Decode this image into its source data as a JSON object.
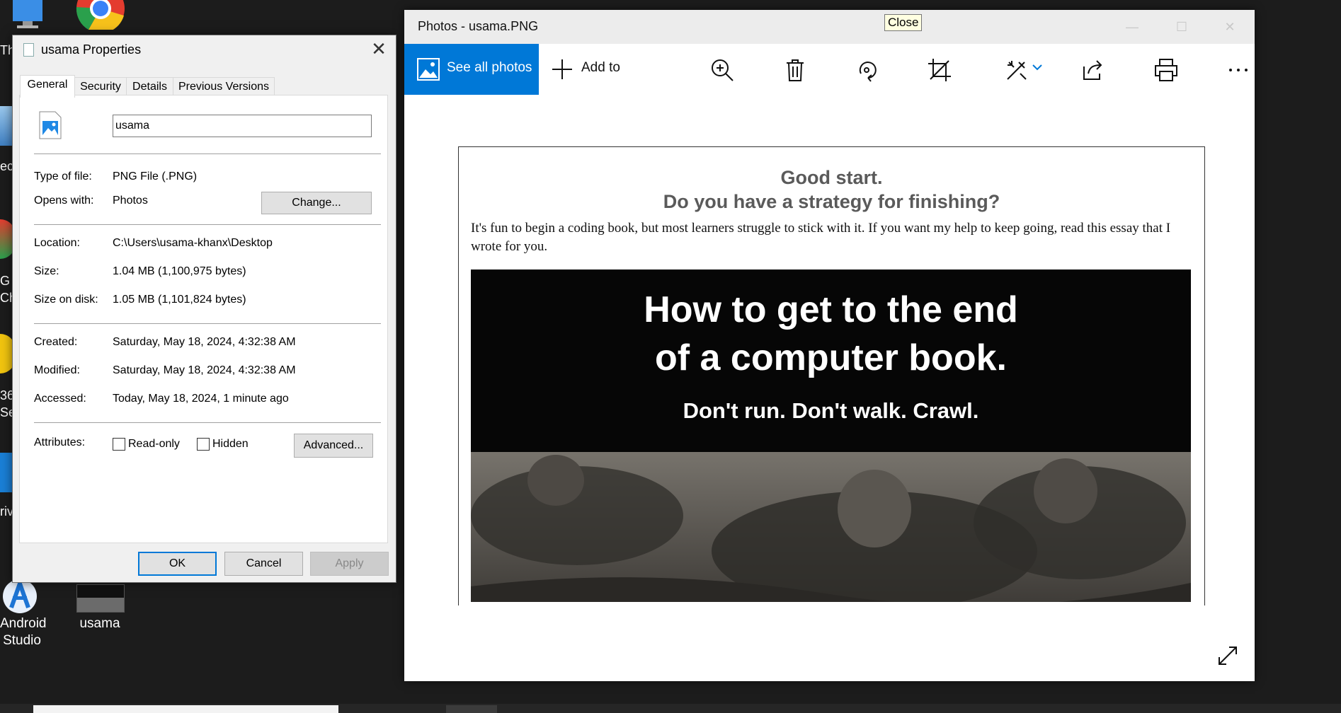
{
  "desktop": {
    "icons": [
      {
        "label": "Android\nStudio"
      },
      {
        "label": "usama"
      }
    ],
    "edge_labels": [
      "Th",
      "ec",
      "G",
      "Ch",
      "36",
      "Se",
      "riv"
    ]
  },
  "properties_dialog": {
    "title": "usama Properties",
    "tabs": [
      "General",
      "Security",
      "Details",
      "Previous Versions"
    ],
    "active_tab": "General",
    "filename": "usama",
    "type_label": "Type of file:",
    "type_value": "PNG File (.PNG)",
    "opens_label": "Opens with:",
    "opens_value": "Photos",
    "change_button": "Change...",
    "location_label": "Location:",
    "location_value": "C:\\Users\\usama-khanx\\Desktop",
    "size_label": "Size:",
    "size_value": "1.04 MB (1,100,975 bytes)",
    "size_on_disk_label": "Size on disk:",
    "size_on_disk_value": "1.05 MB (1,101,824 bytes)",
    "created_label": "Created:",
    "created_value": "Saturday, May 18, 2024, 4:32:38 AM",
    "modified_label": "Modified:",
    "modified_value": "Saturday, May 18, 2024, 4:32:38 AM",
    "accessed_label": "Accessed:",
    "accessed_value": "Today, May 18, 2024, 1 minute ago",
    "attributes_label": "Attributes:",
    "readonly_label": "Read-only",
    "readonly_checked": false,
    "hidden_label": "Hidden",
    "hidden_checked": false,
    "advanced_button": "Advanced...",
    "ok_button": "OK",
    "cancel_button": "Cancel",
    "apply_button": "Apply"
  },
  "photos_window": {
    "title": "Photos - usama.PNG",
    "tooltip": "Close",
    "see_all_label": "See all photos",
    "add_to_label": "Add to",
    "accent_color": "#0078d7",
    "toolbar_icons": [
      "zoom-in-icon",
      "delete-icon",
      "rotate-icon",
      "crop-icon",
      "edit-icon",
      "share-icon",
      "print-icon",
      "more-icon"
    ],
    "image": {
      "heading_line1": "Good start.",
      "heading_line2": "Do you have a strategy for finishing?",
      "paragraph": "It's fun to begin a coding book, but most learners struggle to stick with it. If you want my help to keep going, read this essay that I wrote for you.",
      "banner_line1": "How to get to the end",
      "banner_line2": "of a computer book.",
      "banner_line3": "Don't run. Don't walk. Crawl."
    }
  }
}
